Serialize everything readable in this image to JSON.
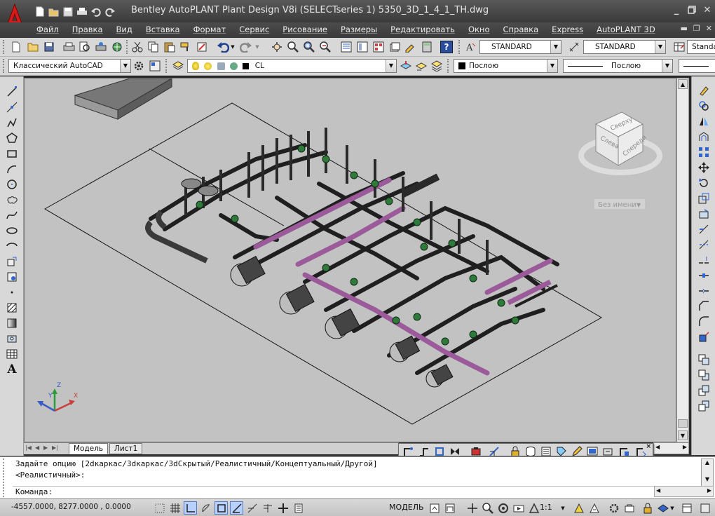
{
  "window": {
    "title": "Bentley AutoPLANT Plant Design V8i (SELECTseries 1) 5350_3D_1_4_1_TH.dwg"
  },
  "menu": [
    "Файл",
    "Правка",
    "Вид",
    "Вставка",
    "Формат",
    "Сервис",
    "Рисование",
    "Размеры",
    "Редактировать",
    "Окно",
    "Справка",
    "Express",
    "AutoPLANT 3D"
  ],
  "toolbar": {
    "text_style": "STANDARD",
    "dim_style": "STANDARD",
    "table_style": "Standa",
    "workspace": "Классический AutoCAD",
    "layer": "CL",
    "color": "Послою",
    "linetype": "Послою"
  },
  "viewcube": {
    "top": "Сверху",
    "left": "Слева",
    "front": "Спереди",
    "ucs": "Без имени"
  },
  "ucs_icon": {
    "x": "X",
    "y": "Y",
    "z": "Z"
  },
  "tabs": {
    "model": "Модель",
    "sheet1": "Лист1"
  },
  "command": {
    "line1": "Задайте опцию [2dкаркас/3dкаркас/3dСкрытый/Реалистичный/Концептуальный/Другой]",
    "line2": "<Реалистичный>:",
    "prompt": "Команда:"
  },
  "status": {
    "coords": "-4557.0000, 8277.0000 , 0.0000",
    "model": "МОДЕЛЬ",
    "scale": "1:1"
  },
  "colors": {
    "viewport_bg": "#c2c2c2",
    "pipe_purple": "#9b5a9a",
    "valve_green": "#2f7a3a",
    "title_bg": "#444444"
  }
}
